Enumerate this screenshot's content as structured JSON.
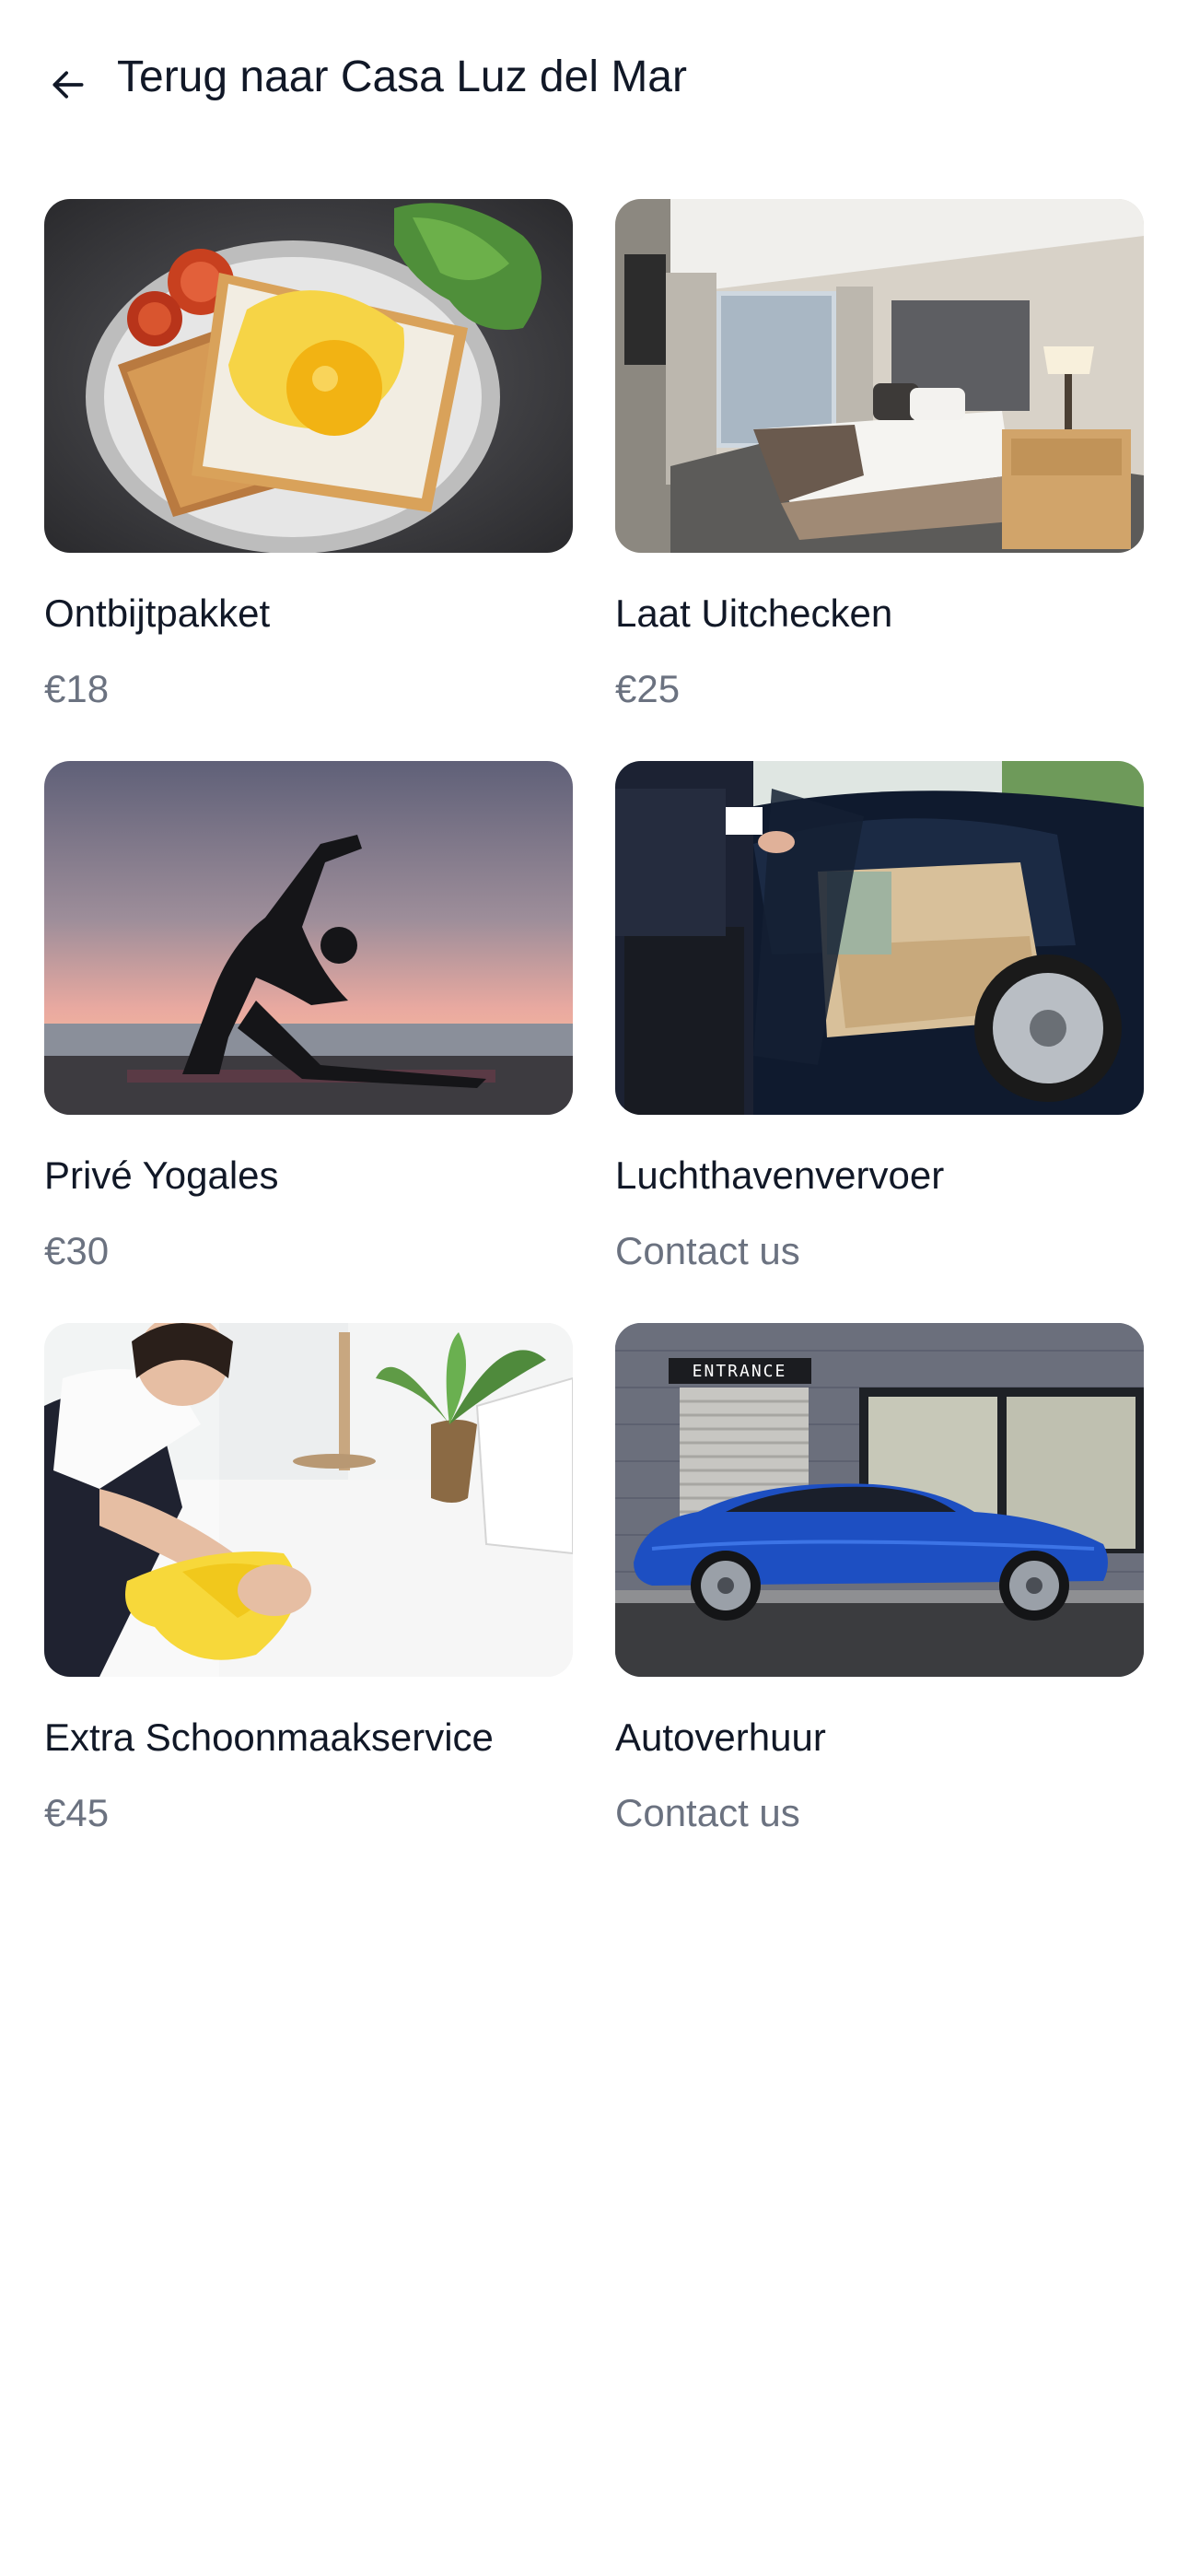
{
  "header": {
    "back_icon": "arrow-left-icon",
    "title": "Terug naar Casa Luz del Mar"
  },
  "services": [
    {
      "title": "Ontbijtpakket",
      "price": "€18",
      "image": "breakfast-photo"
    },
    {
      "title": "Laat Uitchecken",
      "price": "€25",
      "image": "hotel-room-photo"
    },
    {
      "title": "Privé Yogales",
      "price": "€30",
      "image": "yoga-sunset-photo"
    },
    {
      "title": "Luchthavenvervoer",
      "price": "Contact us",
      "image": "chauffeur-car-photo"
    },
    {
      "title": "Extra Schoonmaakservice",
      "price": "€45",
      "image": "cleaning-photo"
    },
    {
      "title": "Autoverhuur",
      "price": "Contact us",
      "image": "blue-car-photo"
    }
  ],
  "images": {
    "entrance_sign": "ENTRANCE"
  },
  "colors": {
    "text_primary": "#111827",
    "text_secondary": "#6b7280",
    "background": "#ffffff"
  }
}
